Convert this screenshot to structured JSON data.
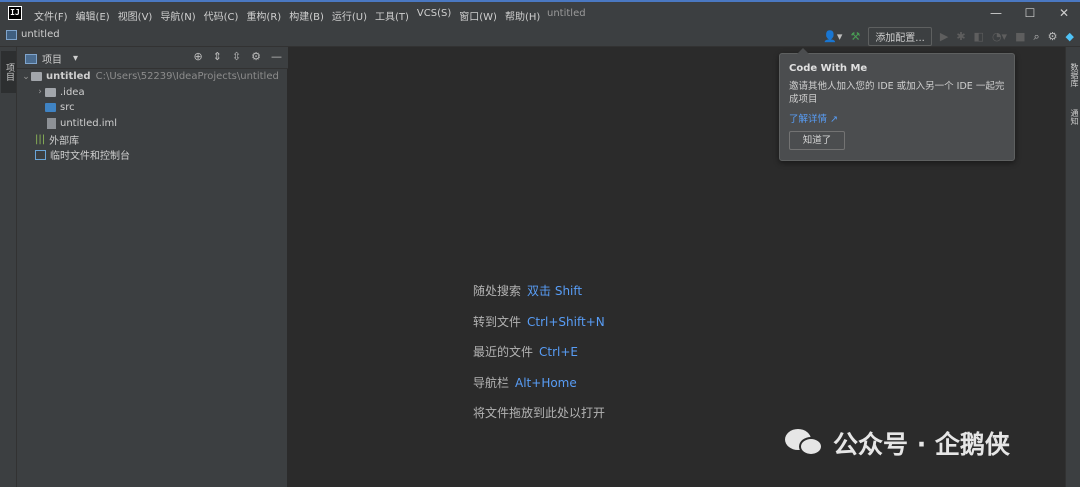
{
  "app": {
    "logo_text": "IJ",
    "window_title": "untitled"
  },
  "menu": [
    "文件(F)",
    "编辑(E)",
    "视图(V)",
    "导航(N)",
    "代码(C)",
    "重构(R)",
    "构建(B)",
    "运行(U)",
    "工具(T)",
    "VCS(S)",
    "窗口(W)",
    "帮助(H)"
  ],
  "window_controls": {
    "minimize": "—",
    "maximize": "☐",
    "close": "✕"
  },
  "navbar": {
    "project_name": "untitled",
    "add_config_label": "添加配置..."
  },
  "left_stripe": {
    "project_tab": "项目"
  },
  "right_stripe": {
    "tab1": "数据库",
    "tab2": "通知"
  },
  "panel": {
    "title": "项目",
    "dropdown_icon": "▾"
  },
  "tree": {
    "root": {
      "name": "untitled",
      "path": "C:\\Users\\52239\\IdeaProjects\\untitled"
    },
    "idea": ".idea",
    "src": "src",
    "iml": "untitled.iml",
    "external_libs": "外部库",
    "scratches": "临时文件和控制台"
  },
  "welcome": [
    {
      "label": "随处搜索",
      "key": "双击 Shift"
    },
    {
      "label": "转到文件",
      "key": "Ctrl+Shift+N"
    },
    {
      "label": "最近的文件",
      "key": "Ctrl+E"
    },
    {
      "label": "导航栏",
      "key": "Alt+Home"
    },
    {
      "label": "将文件拖放到此处以打开",
      "key": ""
    }
  ],
  "popup": {
    "title": "Code With Me",
    "body": "邀请其他人加入您的 IDE 或加入另一个 IDE 一起完成项目",
    "link": "了解详情 ↗",
    "button": "知道了"
  },
  "watermark": "公众号 · 企鹅侠",
  "icons": [
    "user-icon",
    "hammer-icon",
    "run-icon",
    "debug-icon",
    "coverage-icon",
    "profile-icon",
    "stop-icon",
    "search-icon",
    "gear-icon",
    "plugin-icon"
  ],
  "colors": {
    "accent_link": "#589df6",
    "panel_bg": "#3c3f41",
    "editor_bg": "#2b2b2b",
    "hammer": "#499c54"
  }
}
